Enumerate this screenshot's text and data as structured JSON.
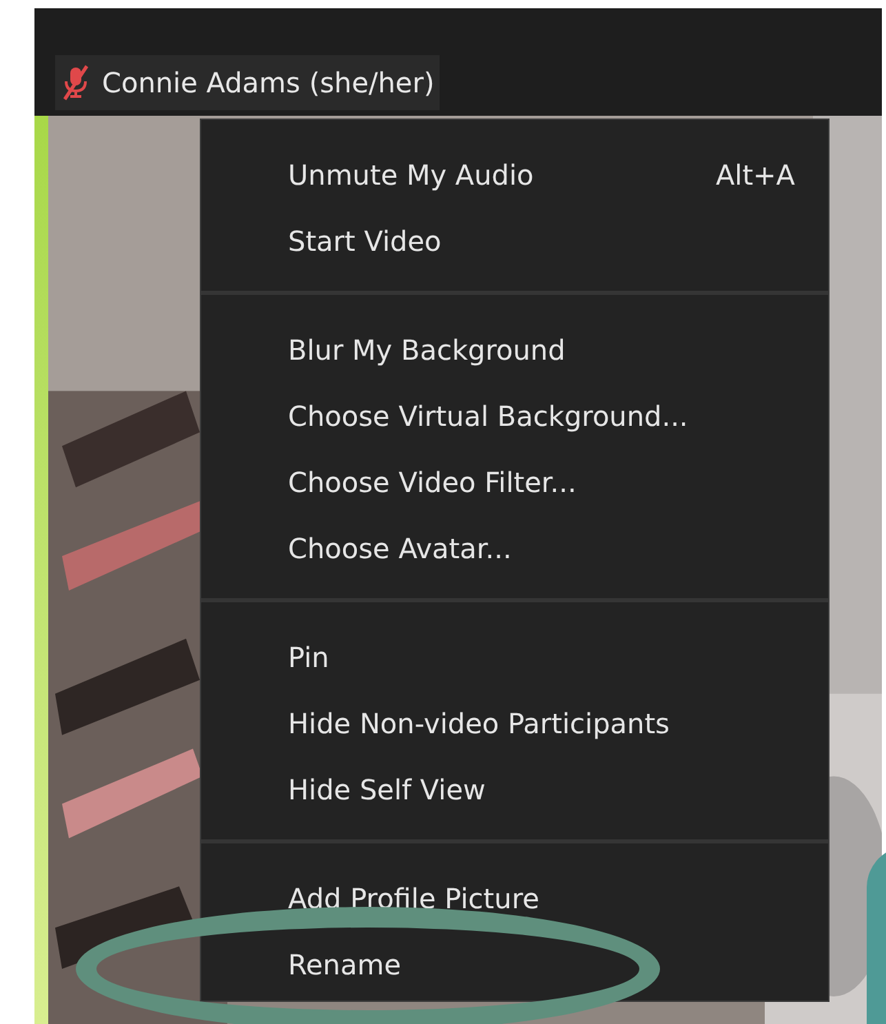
{
  "participant": {
    "name": "Connie Adams (she/her)",
    "audio_muted": true
  },
  "menu": {
    "groups": [
      [
        {
          "label": "Unmute My Audio",
          "shortcut": "Alt+A"
        },
        {
          "label": "Start Video"
        }
      ],
      [
        {
          "label": "Blur My Background"
        },
        {
          "label": "Choose Virtual Background..."
        },
        {
          "label": "Choose Video Filter..."
        },
        {
          "label": "Choose Avatar..."
        }
      ],
      [
        {
          "label": "Pin"
        },
        {
          "label": "Hide Non-video Participants"
        },
        {
          "label": "Hide Self View"
        }
      ],
      [
        {
          "label": "Add Profile Picture"
        },
        {
          "label": "Rename"
        }
      ]
    ]
  }
}
